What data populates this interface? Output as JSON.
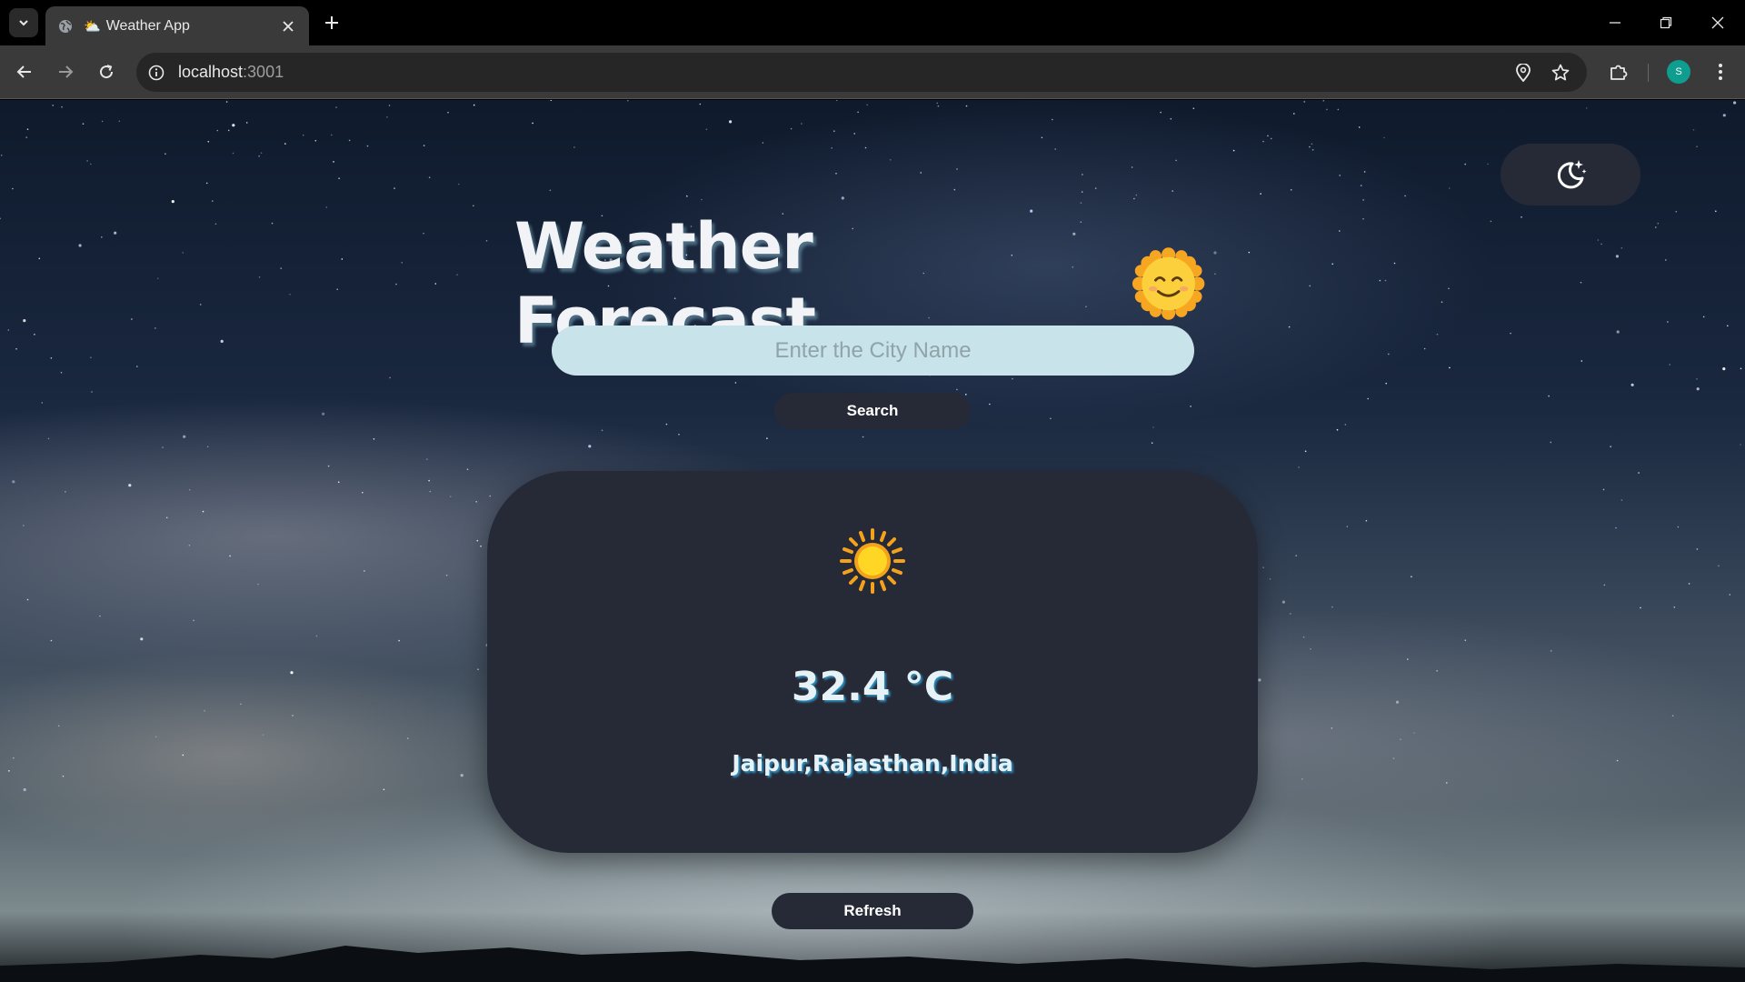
{
  "browser": {
    "tab_title": "Weather App",
    "tab_emoji": "⛅",
    "url_host": "localhost",
    "url_port": ":3001",
    "profile_initial": "S"
  },
  "page": {
    "title": "Weather Forecast",
    "search": {
      "placeholder": "Enter the City Name",
      "value": ""
    },
    "search_label": "Search",
    "refresh_label": "Refresh",
    "weather": {
      "temperature": "32.4 °C",
      "location": "Jaipur,Rajasthan,India",
      "condition_icon": "sun-icon"
    },
    "theme_icon": "moon-stars-icon"
  },
  "colors": {
    "card_bg": "#262a36",
    "input_bg": "#c9e3ea",
    "text_glow": "#2f8fc0",
    "profile": "#0f9d8f"
  }
}
